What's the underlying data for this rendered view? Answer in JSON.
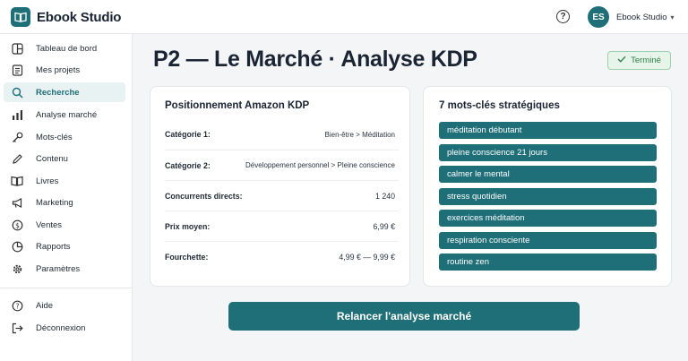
{
  "app": {
    "name": "Ebook Studio"
  },
  "header": {
    "help_icon_glyph": "?",
    "user": {
      "initials": "ES",
      "name": "Ebook Studio"
    }
  },
  "sidebar": {
    "items": [
      {
        "label": "Tableau de bord",
        "icon": "dashboard-icon",
        "active": false
      },
      {
        "label": "Mes projets",
        "icon": "projects-icon",
        "active": false
      },
      {
        "label": "Recherche",
        "icon": "search-icon",
        "active": true
      },
      {
        "label": "Analyse marché",
        "icon": "bar-chart-icon",
        "active": false
      },
      {
        "label": "Mots-clés",
        "icon": "key-icon",
        "active": false
      },
      {
        "label": "Contenu",
        "icon": "pencil-icon",
        "active": false
      },
      {
        "label": "Livres",
        "icon": "book-icon",
        "active": false
      },
      {
        "label": "Marketing",
        "icon": "megaphone-icon",
        "active": false
      },
      {
        "label": "Ventes",
        "icon": "dollar-icon",
        "active": false
      },
      {
        "label": "Rapports",
        "icon": "pie-chart-icon",
        "active": false
      },
      {
        "label": "Paramètres",
        "icon": "gear-icon",
        "active": false
      }
    ],
    "bottom": [
      {
        "label": "Aide",
        "icon": "help-icon"
      },
      {
        "label": "Déconnexion",
        "icon": "logout-icon"
      }
    ]
  },
  "page": {
    "title": "P2 — Le Marché · Analyse KDP",
    "status": "Terminé"
  },
  "positioning": {
    "title": "Positionnement Amazon KDP",
    "rows": [
      {
        "label": "Catégorie 1:",
        "value": "Bien-être > Méditation"
      },
      {
        "label": "Catégorie 2:",
        "value": "Développement personnel > Pleine conscience"
      },
      {
        "label": "Concurrents directs:",
        "value": "1 240"
      },
      {
        "label": "Prix moyen:",
        "value": "6,99 €"
      },
      {
        "label": "Fourchette:",
        "value": "4,99 € — 9,99 €"
      }
    ]
  },
  "keywords": {
    "title": "7 mots-clés stratégiques",
    "items": [
      "méditation débutant",
      "pleine conscience 21 jours",
      "calmer le mental",
      "stress quotidien",
      "exercices méditation",
      "respiration consciente",
      "routine zen"
    ]
  },
  "actions": {
    "rerun": "Relancer l'analyse marché"
  },
  "colors": {
    "accent": "#1f6f78",
    "success_bg": "#e6f4ea",
    "success_text": "#2f7d4a"
  }
}
